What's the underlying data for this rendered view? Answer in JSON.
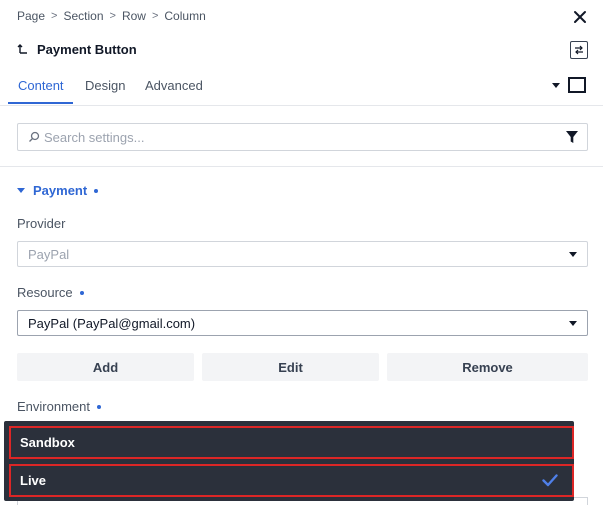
{
  "breadcrumb": [
    "Page",
    "Section",
    "Row",
    "Column"
  ],
  "panel": {
    "title": "Payment Button"
  },
  "tabs": [
    {
      "label": "Content",
      "active": true
    },
    {
      "label": "Design",
      "active": false
    },
    {
      "label": "Advanced",
      "active": false
    }
  ],
  "search": {
    "placeholder": "Search settings..."
  },
  "section": {
    "title": "Payment"
  },
  "fields": {
    "provider": {
      "label": "Provider",
      "value": "PayPal"
    },
    "resource": {
      "label": "Resource",
      "value": "PayPal (PayPal@gmail.com)"
    },
    "environment": {
      "label": "Environment"
    }
  },
  "buttons": {
    "add": "Add",
    "edit": "Edit",
    "remove": "Remove"
  },
  "dropdown": {
    "options": [
      {
        "label": "Sandbox",
        "selected": false
      },
      {
        "label": "Live",
        "selected": true
      }
    ]
  },
  "colors": {
    "accent": "#2f67d4",
    "highlight": "#dc2626",
    "dropdown_bg": "#2b303b"
  }
}
